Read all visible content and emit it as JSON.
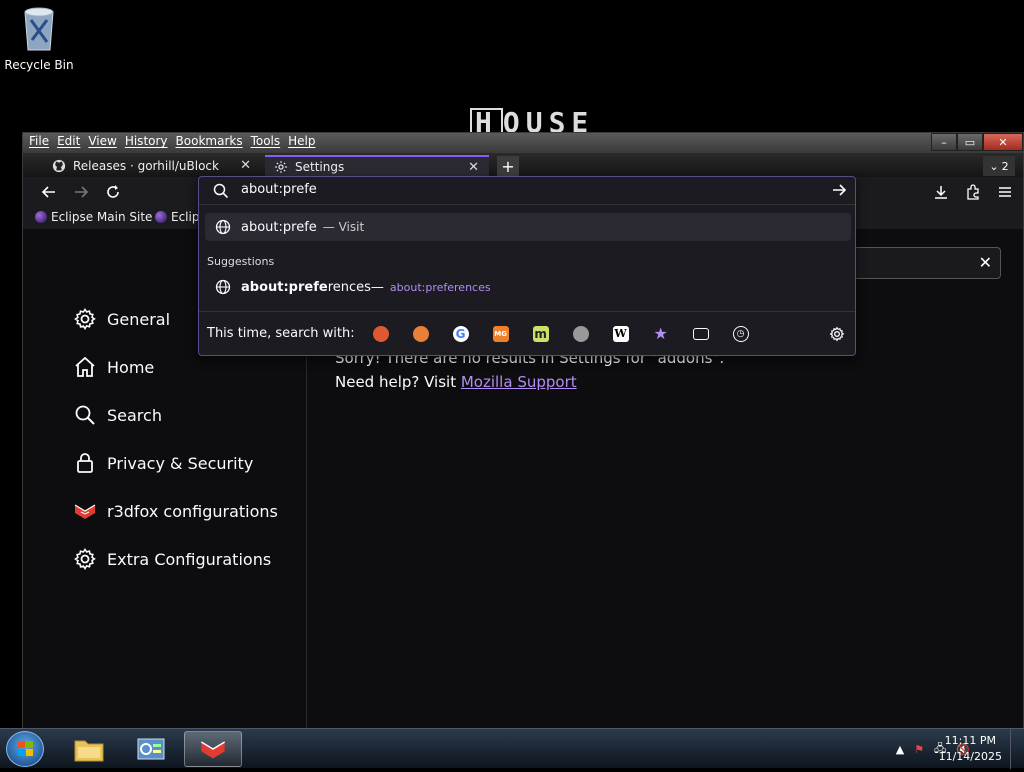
{
  "desktop": {
    "recycle_bin_label": "Recycle Bin",
    "wallpaper_logo": "HOUSE"
  },
  "menu": [
    "File",
    "Edit",
    "View",
    "History",
    "Bookmarks",
    "Tools",
    "Help"
  ],
  "tabs": [
    {
      "title": "Releases · gorhill/uBlock",
      "icon": "github-icon"
    },
    {
      "title": "Settings",
      "icon": "gear-icon"
    }
  ],
  "tab_count": "2",
  "bookmarks": [
    "Eclipse Main Site",
    "Eclip"
  ],
  "urlbar": {
    "value": "about:prefe",
    "visit_text": "about:prefe",
    "visit_action": "— Visit",
    "suggestions_heading": "Suggestions",
    "suggestion_bold": "about:prefe",
    "suggestion_rest": "rences",
    "suggestion_sep": " —",
    "suggestion_action": "about:preferences",
    "search_with_label": "This time, search with:"
  },
  "sidebar": [
    {
      "label": "General",
      "icon": "gear-icon"
    },
    {
      "label": "Home",
      "icon": "home-icon"
    },
    {
      "label": "Search",
      "icon": "search-icon"
    },
    {
      "label": "Privacy & Security",
      "icon": "lock-icon"
    },
    {
      "label": "r3dfox configurations",
      "icon": "r3dfox-icon"
    },
    {
      "label": "Extra Configurations",
      "icon": "gear-icon"
    }
  ],
  "main": {
    "no_results_text": "Sorry! There are no results in Settings for \"addons\".",
    "help_prefix": "Need help? Visit ",
    "help_link": "Mozilla Support"
  },
  "taskbar": {
    "time": "11:11 PM",
    "date": "11/14/2025"
  }
}
